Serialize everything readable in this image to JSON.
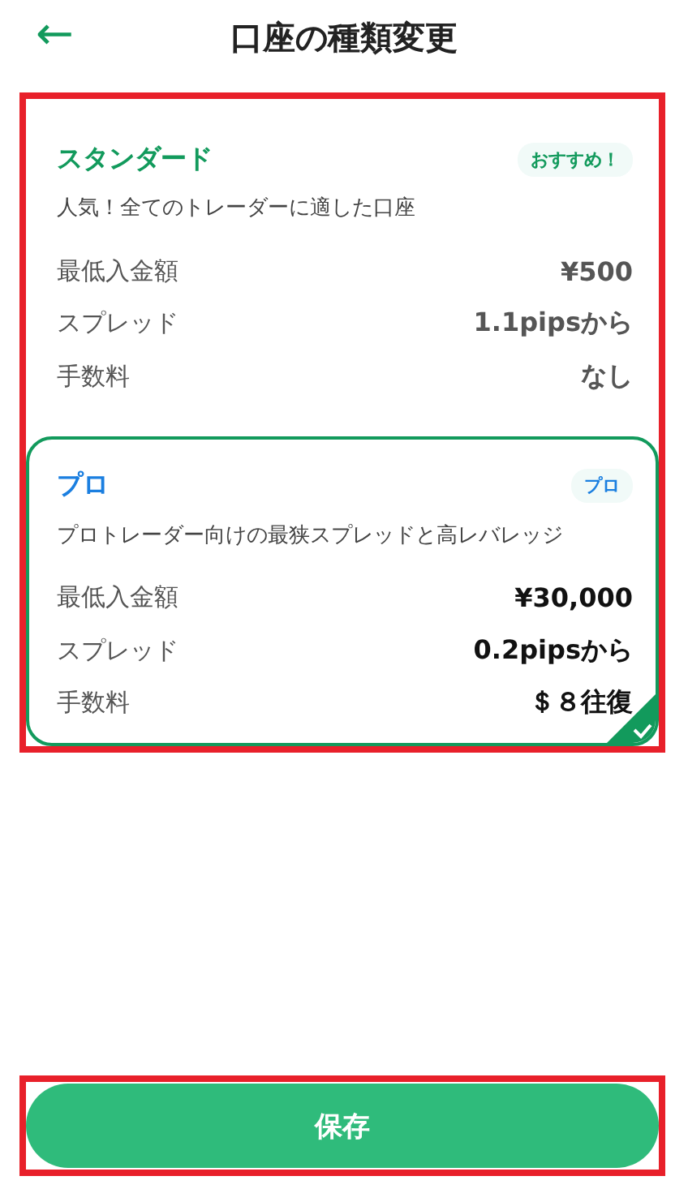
{
  "header": {
    "back_icon": "←",
    "title": "口座の種類変更"
  },
  "plans": [
    {
      "name": "スタンダード",
      "color": "#129a5c",
      "badge": "おすすめ！",
      "description": "人気！全てのトレーダーに適した口座",
      "selected": false,
      "rows": [
        {
          "label": "最低入金額",
          "value": "¥500"
        },
        {
          "label": "スプレッド",
          "value": "1.1pipsから"
        },
        {
          "label": "手数料",
          "value": "なし"
        }
      ]
    },
    {
      "name": "プロ",
      "color": "#1b7fe0",
      "badge": "プロ",
      "description": "プロトレーダー向けの最狭スプレッドと高レバレッジ",
      "selected": true,
      "rows": [
        {
          "label": "最低入金額",
          "value": "¥30,000"
        },
        {
          "label": "スプレッド",
          "value": "0.2pipsから"
        },
        {
          "label": "手数料",
          "value": "＄８往復"
        }
      ]
    }
  ],
  "save_button": "保存"
}
